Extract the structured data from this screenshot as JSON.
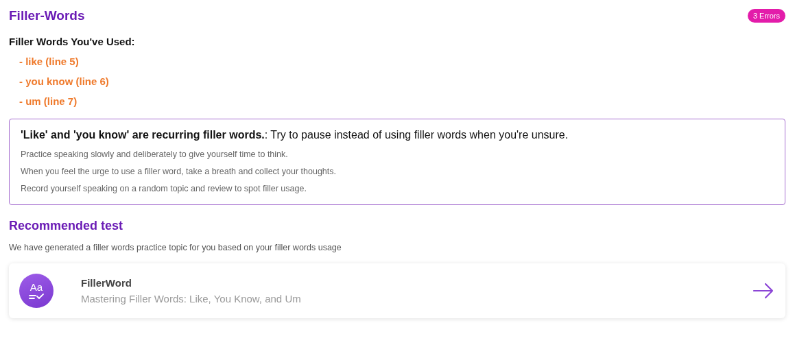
{
  "header": {
    "title": "Filler-Words",
    "badge": "3 Errors"
  },
  "used": {
    "heading": "Filler Words You've Used:",
    "items": [
      {
        "text": "- like (line 5)"
      },
      {
        "text": "- you know (line 6)"
      },
      {
        "text": "- um (line 7)"
      }
    ]
  },
  "advice": {
    "headline": "**'Like' and 'you know' are recurring filler words.**: Try to pause instead of using filler words when you're unsure.",
    "tips": [
      "Practice speaking slowly and deliberately to give yourself time to think.",
      "When you feel the urge to use a filler word, take a breath and collect your thoughts.",
      "Record yourself speaking on a random topic and review to spot filler usage."
    ]
  },
  "recommended": {
    "title": "Recommended test",
    "description": "We have generated a filler words practice topic for you based on your filler words usage",
    "card": {
      "icon_label": "Aa",
      "title": "FillerWord",
      "subtitle": "Mastering Filler Words: Like, You Know, and Um"
    }
  }
}
